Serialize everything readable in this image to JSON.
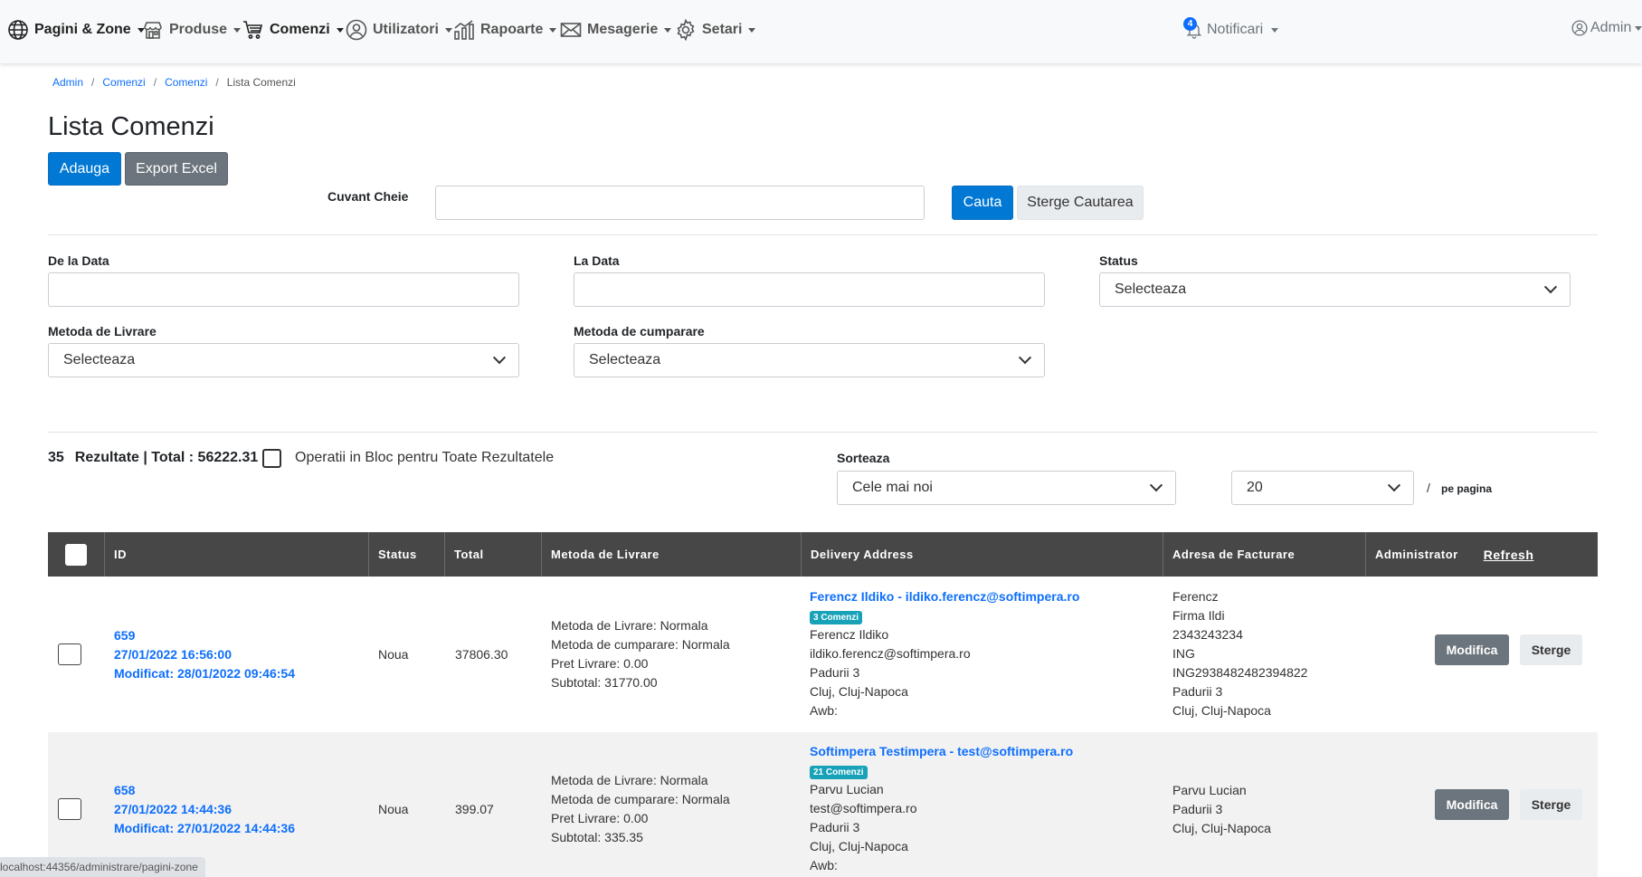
{
  "nav": {
    "items": [
      {
        "label": "Pagini & Zone",
        "icon": "globe-icon"
      },
      {
        "label": "Produse",
        "icon": "store-icon"
      },
      {
        "label": "Comenzi",
        "icon": "cart-icon"
      },
      {
        "label": "Utilizatori",
        "icon": "user-circle-icon"
      },
      {
        "label": "Rapoarte",
        "icon": "chart-icon"
      },
      {
        "label": "Mesagerie",
        "icon": "envelope-icon"
      },
      {
        "label": "Setari",
        "icon": "gear-icon"
      }
    ],
    "notifications": {
      "label": "Notificari",
      "count": "4",
      "icon": "bell-icon"
    },
    "user": {
      "label": "Admin",
      "icon": "user-circle-icon"
    }
  },
  "breadcrumb": [
    "Admin",
    "Comenzi",
    "Comenzi",
    "Lista Comenzi"
  ],
  "page": {
    "title": "Lista Comenzi",
    "add_label": "Adauga",
    "export_label": "Export Excel"
  },
  "search": {
    "keyword_label": "Cuvant Cheie",
    "keyword_value": "",
    "search_label": "Cauta",
    "clear_label": "Sterge Cautarea"
  },
  "filters": {
    "from_date_label": "De la Data",
    "to_date_label": "La Data",
    "status_label": "Status",
    "status_value": "Selecteaza",
    "delivery_label": "Metoda de Livrare",
    "delivery_value": "Selecteaza",
    "purchase_label": "Metoda de cumparare",
    "purchase_value": "Selecteaza"
  },
  "results": {
    "count": "35",
    "summary": "Rezultate | Total : 56222.31",
    "bulk_label": "Operatii in Bloc pentru Toate Rezultatele",
    "sort_label": "Sorteaza",
    "sort_value": "Cele mai noi",
    "per_page_value": "20",
    "per_page_sep": "/",
    "per_page_label": "pe pagina"
  },
  "table": {
    "headers": [
      "ID",
      "Status",
      "Total",
      "Metoda de Livrare",
      "Delivery Address",
      "Adresa de Facturare",
      "Administrator"
    ],
    "refresh_label": "Refresh",
    "edit_label": "Modifica",
    "delete_label": "Sterge",
    "rows": [
      {
        "id": "659",
        "created": "27/01/2022 16:56:00",
        "modified": "Modificat: 28/01/2022 09:46:54",
        "status": "Noua",
        "total": "37806.30",
        "delivery": [
          "Metoda de Livrare: Normala",
          "Metoda de cumparare: Normala",
          "Pret Livrare: 0.00",
          "Subtotal: 31770.00"
        ],
        "customer": "Ferencz Ildiko - ildiko.ferencz@softimpera.ro",
        "orders_badge": "3 Comenzi",
        "address": [
          "Ferencz Ildiko",
          "ildiko.ferencz@softimpera.ro",
          "Padurii 3",
          "Cluj, Cluj-Napoca",
          "Awb:"
        ],
        "billing": [
          "Ferencz",
          "Firma Ildi",
          "2343243234",
          "ING",
          "ING2938482482394822",
          "Padurii 3",
          "Cluj, Cluj-Napoca"
        ]
      },
      {
        "id": "658",
        "created": "27/01/2022 14:44:36",
        "modified": "Modificat: 27/01/2022 14:44:36",
        "status": "Noua",
        "total": "399.07",
        "delivery": [
          "Metoda de Livrare: Normala",
          "Metoda de cumparare: Normala",
          "Pret Livrare: 0.00",
          "Subtotal: 335.35"
        ],
        "customer": "Softimpera Testimpera - test@softimpera.ro",
        "orders_badge": "21 Comenzi",
        "address": [
          "Parvu Lucian",
          "test@softimpera.ro",
          "Padurii 3",
          "Cluj, Cluj-Napoca",
          "Awb:"
        ],
        "billing": [
          "Parvu Lucian",
          "Padurii 3",
          "Cluj, Cluj-Napoca"
        ]
      }
    ]
  },
  "status_bar": {
    "url": "localhost:44356/administrare/pagini-zone"
  }
}
